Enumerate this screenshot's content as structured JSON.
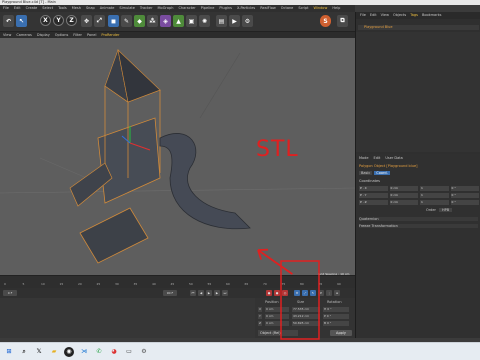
{
  "window": {
    "title": "Playground Blue.c4d [T] - Main"
  },
  "menubar": [
    "File",
    "Edit",
    "Create",
    "Select",
    "Tools",
    "Mesh",
    "Snap",
    "Animate",
    "Simulate",
    "Tracker",
    "MoGraph",
    "Character",
    "Pipeline",
    "Plugins",
    "X-Particles",
    "RealFlow",
    "Octane",
    "Script",
    "Window",
    "Help"
  ],
  "viewmenu": [
    "View",
    "Cameras",
    "Display",
    "Options",
    "Filter",
    "Panel",
    "ProRender"
  ],
  "toolbar": {
    "axis_buttons": [
      "X",
      "Y",
      "Z"
    ],
    "tools": [
      "move-icon",
      "scale-icon",
      "rotate-icon",
      "cube-icon",
      "pen-icon",
      "subdivide-icon",
      "array-icon",
      "deformer-icon",
      "scene-icon",
      "camera-icon",
      "light-icon"
    ]
  },
  "annotation": {
    "text": "STL",
    "color": "#e02020"
  },
  "right_panel": {
    "tabs": [
      "File",
      "Edit",
      "View",
      "Objects",
      "Tags",
      "Bookmarks"
    ],
    "object_name": "Playground Blue",
    "attr_menu": [
      "Mode",
      "Edit",
      "User Data"
    ],
    "attr_title": "Polygon Object [Playground blue]",
    "attr_tabs": [
      "Basic",
      "Coord."
    ],
    "section": "Coordinates",
    "coord_rows": [
      {
        "label": "P . X",
        "value": "0 cm",
        "s": "1",
        "r": "0 °"
      },
      {
        "label": "P . Y",
        "value": "0 cm",
        "s": "1",
        "r": "0 °"
      },
      {
        "label": "P . Z",
        "value": "0 cm",
        "s": "1",
        "r": "0 °"
      }
    ],
    "order_label": "Order",
    "order_value": "HPB",
    "quaternion": "Quaternion",
    "freeze": "Freeze Transformation"
  },
  "timeline": {
    "ticks": [
      "0",
      "5",
      "10",
      "15",
      "20",
      "25",
      "30",
      "35",
      "40",
      "45",
      "50",
      "55",
      "60",
      "65",
      "70",
      "75",
      "80",
      "85",
      "90"
    ],
    "start": "0 F",
    "end": "90 F",
    "spacing": "Grid Spacing : 10 cm"
  },
  "coordinates": {
    "headers": [
      "Position",
      "Size",
      "Rotation"
    ],
    "rows": [
      {
        "axis": "X",
        "pos": "0 cm",
        "size": "77.535 cm",
        "rot": "H 0 °"
      },
      {
        "axis": "Y",
        "pos": "0 cm",
        "size": "43.212 cm",
        "rot": "P 0 °"
      },
      {
        "axis": "Z",
        "pos": "0 cm",
        "size": "50.695 cm",
        "rot": "B 0 °"
      }
    ],
    "mode": "Object (Rel)",
    "apply": "Apply"
  },
  "taskbar": {
    "icons": [
      "windows-icon",
      "search-icon",
      "x-app-icon",
      "folder-icon",
      "cinema4d-icon",
      "vscode-icon",
      "whatsapp-icon",
      "chrome-icon",
      "terminal-icon",
      "settings-icon"
    ]
  }
}
